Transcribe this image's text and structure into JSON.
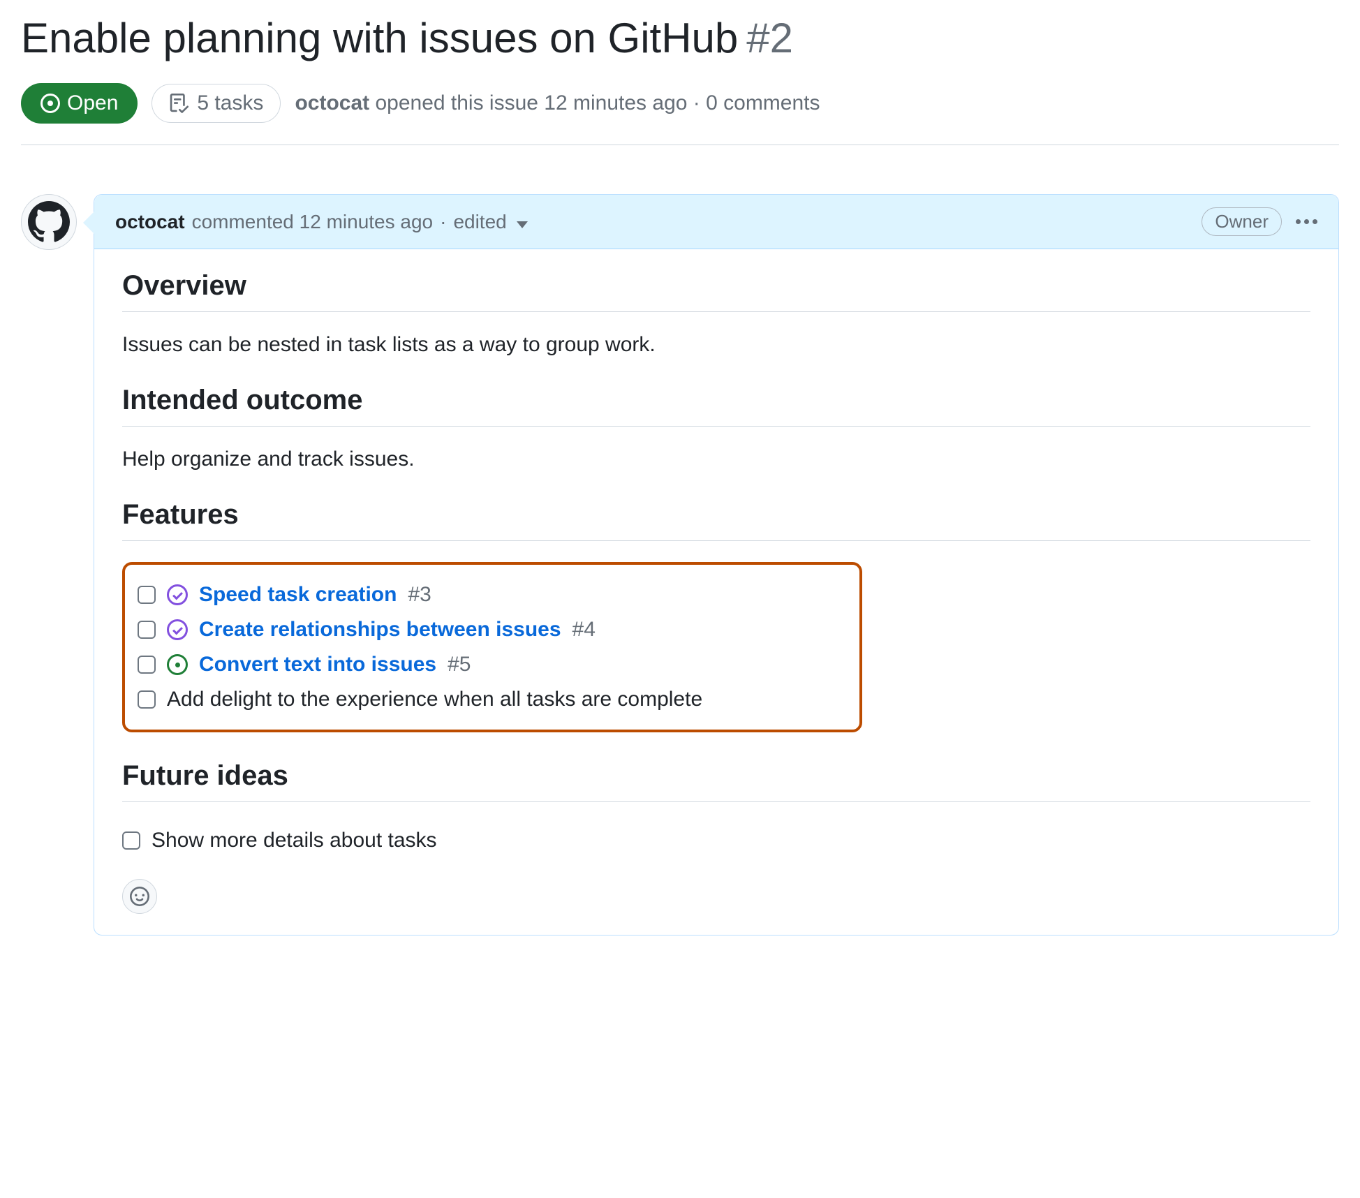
{
  "issue": {
    "title": "Enable planning with issues on GitHub",
    "number": "#2",
    "state": "Open",
    "tasks_summary": "5 tasks",
    "author": "octocat",
    "opened_text": "opened this issue 12 minutes ago",
    "comments_text": "0 comments"
  },
  "comment": {
    "author": "octocat",
    "timestamp_text": "commented 12 minutes ago",
    "edited_label": "edited",
    "role_badge": "Owner",
    "sections": {
      "overview_heading": "Overview",
      "overview_text": "Issues can be nested in task lists as a way to group work.",
      "outcome_heading": "Intended outcome",
      "outcome_text": "Help organize and track issues.",
      "features_heading": "Features",
      "future_heading": "Future ideas"
    },
    "feature_tasks": [
      {
        "status": "closed",
        "title": "Speed task creation",
        "ref": "#3"
      },
      {
        "status": "closed",
        "title": "Create relationships between issues",
        "ref": "#4"
      },
      {
        "status": "open",
        "title": "Convert text into issues",
        "ref": "#5"
      },
      {
        "status": "none",
        "title": "Add delight to the experience when all tasks are complete",
        "ref": ""
      }
    ],
    "future_tasks": [
      {
        "status": "none",
        "title": "Show more details about tasks",
        "ref": ""
      }
    ]
  }
}
